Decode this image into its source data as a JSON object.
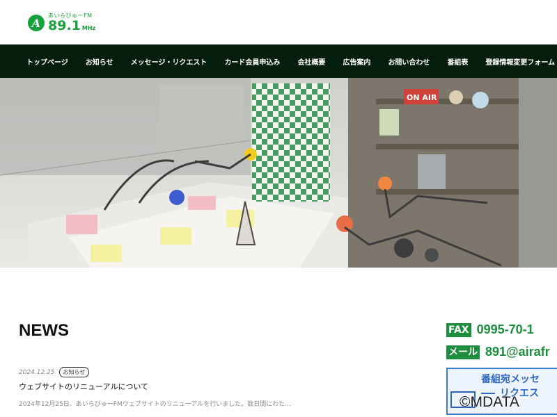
{
  "logo": {
    "small_text": "あいらびゅーFM",
    "frequency": "89.1",
    "unit": "MHz",
    "mark": "A"
  },
  "nav": {
    "items": [
      "トップページ",
      "お知らせ",
      "メッセージ・リクエスト",
      "カード会員申込み",
      "会社概要",
      "広告案内",
      "お問い合わせ",
      "番組表",
      "登録情報変更フォーム"
    ]
  },
  "hero": {
    "sign_text": "ON AIR"
  },
  "news": {
    "title": "NEWS",
    "items": [
      {
        "date": "2024.12.25",
        "badge": "お知らせ",
        "headline": "ウェブサイトのリニューアルについて",
        "excerpt": "2024年12月25日、あいらびゅーFMウェブサイトのリニューアルを行いました。数日間にわた..."
      }
    ]
  },
  "contact": {
    "fax_label": "FAX",
    "fax_value": "0995-70-1",
    "mail_label": "メール",
    "mail_value": "891@airafr"
  },
  "banner": {
    "line1": "番組宛メッセ",
    "line2": "リクエス"
  },
  "watermark": "©MDATA",
  "colors": {
    "brand_green": "#17a13a",
    "nav_bg": "#051d0c",
    "contact_green": "#1d8e3e",
    "banner_blue": "#2d66c6"
  }
}
